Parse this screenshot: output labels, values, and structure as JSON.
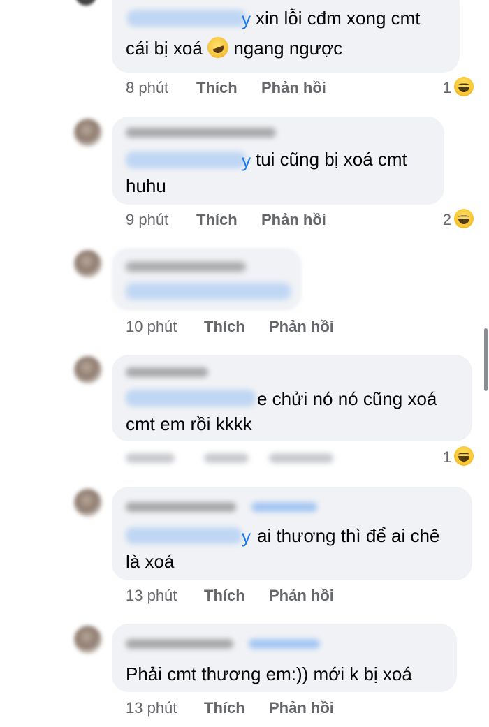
{
  "actions": {
    "like": "Thích",
    "reply": "Phản hồi"
  },
  "mention_tail": "y",
  "comments": [
    {
      "lines": [
        "xin lỗi cđm xong cmt",
        "cái bị xoá",
        "ngang ngược"
      ],
      "time": "8 phút",
      "reactions": "1",
      "reaction_icon": "haha-reaction-icon"
    },
    {
      "lines": [
        "tui cũng bị xoá cmt",
        "huhu"
      ],
      "time": "9 phút",
      "reactions": "2",
      "reaction_icon": "haha-reaction-icon"
    },
    {
      "lines": [],
      "time": "10 phút",
      "reactions": ""
    },
    {
      "lines": [
        "e chửi nó nó cũng xoá",
        "cmt em rồi kkkk"
      ],
      "time": "",
      "reactions": "1",
      "reaction_icon": "haha-reaction-icon"
    },
    {
      "lines": [
        "ai thương thì để ai chê",
        "là xoá"
      ],
      "time": "13 phút",
      "reactions": ""
    },
    {
      "lines": [
        "Phải cmt thương em:)) mới k bị xoá"
      ],
      "time": "13 phút",
      "reactions": ""
    }
  ],
  "inline_emoji": "rolling-on-floor-laughing-icon",
  "colors": {
    "bubble": "#f0f2f5",
    "meta": "#65676b",
    "mention": "#1877f2",
    "reaction": "#f7c631"
  }
}
